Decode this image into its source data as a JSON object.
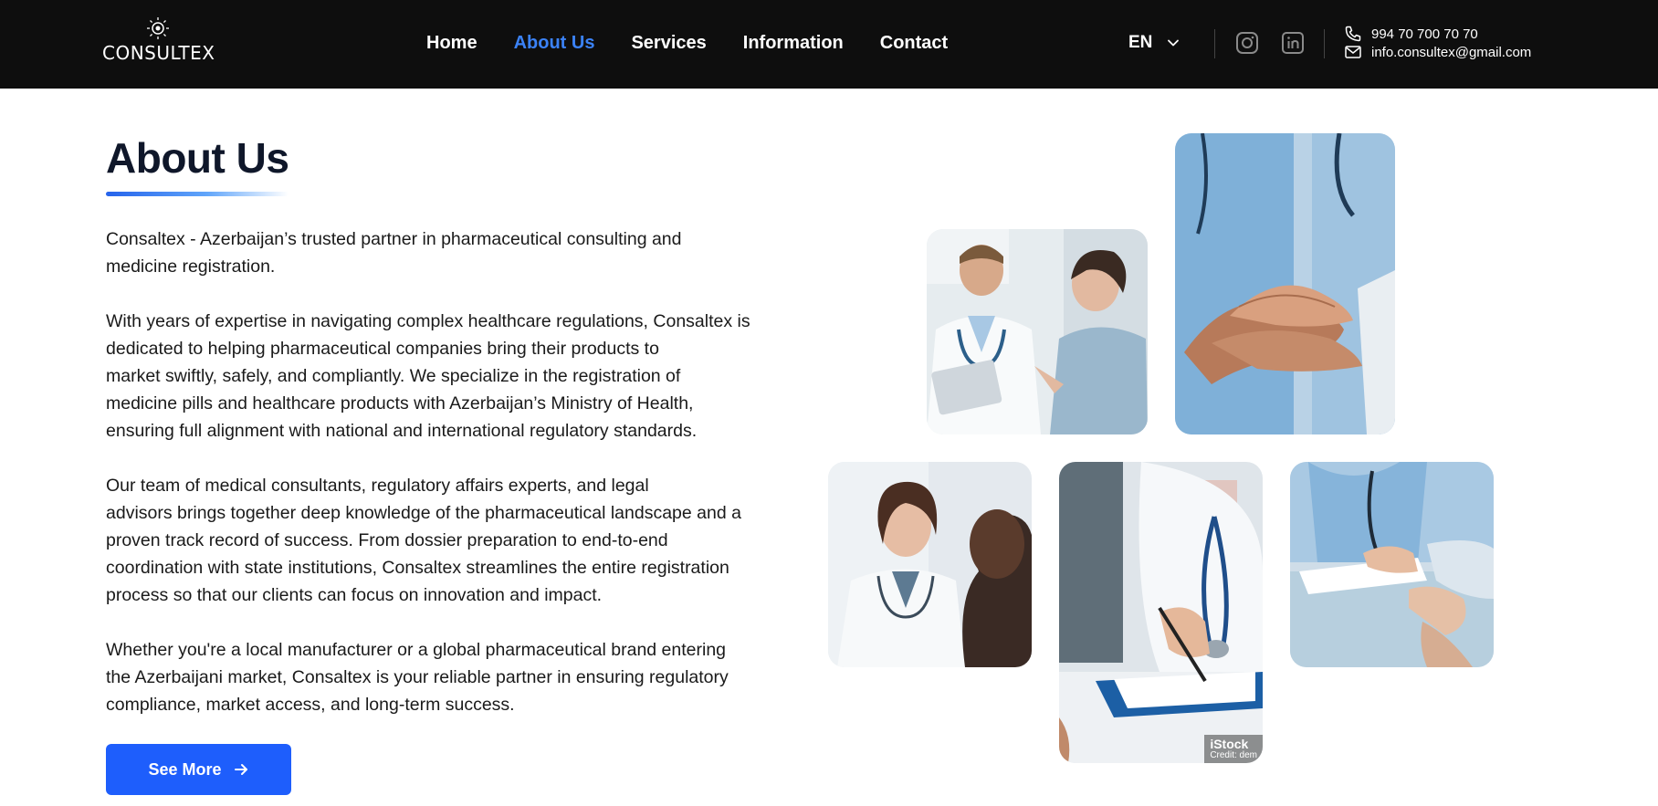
{
  "header": {
    "logo_text": "CONSULTEX",
    "nav": [
      {
        "label": "Home",
        "active": false
      },
      {
        "label": "About Us",
        "active": true
      },
      {
        "label": "Services",
        "active": false
      },
      {
        "label": "Information",
        "active": false
      },
      {
        "label": "Contact",
        "active": false
      }
    ],
    "language": "EN",
    "phone": "994 70 700 70 70",
    "email": "info.consultex@gmail.com",
    "icons": [
      "logo-sun-icon",
      "chevron-down-icon",
      "instagram-icon",
      "linkedin-icon",
      "phone-icon",
      "mail-icon"
    ]
  },
  "about": {
    "title": "About Us",
    "paragraphs": [
      [
        "Consaltex - Azerbaijan’s trusted partner in pharmaceutical consulting and",
        "medicine registration."
      ],
      [
        "With years of expertise in navigating complex healthcare regulations, Consaltex is",
        "dedicated to helping pharmaceutical companies bring their products to",
        "market swiftly, safely, and compliantly. We specialize in the registration of",
        "medicine pills and healthcare products with Azerbaijan’s Ministry of Health,",
        "ensuring full alignment with national and international regulatory standards."
      ],
      [
        "Our team of medical consultants, regulatory affairs experts, and legal",
        "advisors brings together deep knowledge of the pharmaceutical landscape and a",
        "proven track record of success. From dossier preparation to end-to-end",
        "coordination with state institutions, Consaltex streamlines the entire registration",
        "process so that our clients can focus on innovation and impact."
      ],
      [
        "Whether you're a local manufacturer or a global pharmaceutical brand entering",
        "the Azerbaijani market, Consaltex is your reliable partner in ensuring regulatory",
        "compliance, market access, and long-term success."
      ]
    ],
    "button_label": "See More"
  },
  "photos": {
    "watermark": "iStock",
    "watermark_credit": "Credit: dem"
  },
  "colors": {
    "header_bg": "#0e0e0e",
    "accent": "#3b82f6",
    "button": "#1e5efc",
    "title": "#0f172a"
  }
}
